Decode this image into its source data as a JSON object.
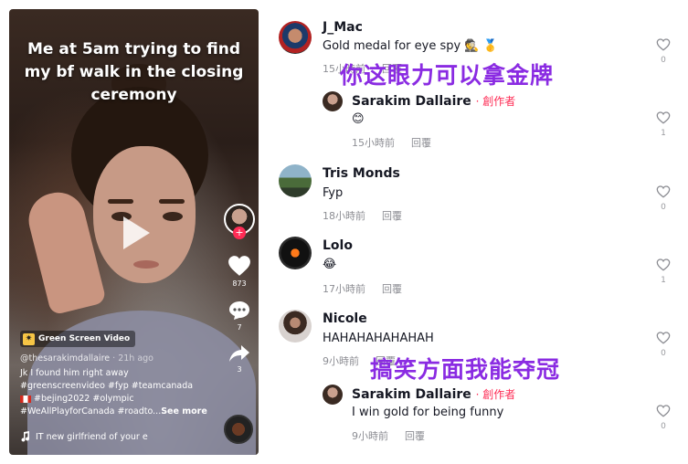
{
  "video": {
    "caption": "Me at 5am trying to find my bf walk in the closing ceremony",
    "badge": "Green Screen Video",
    "handle": "@thesarakimdallaire",
    "time": "· 21h ago",
    "description_line1": "Jk I found him right away",
    "description_line2": "#greenscreenvideo #fyp #teamcanada",
    "description_line3": "#bejing2022 #olympic",
    "description_line4": "#WeAllPlayforCanada #roadto...",
    "see_more": "See more",
    "music": "IT new girlfriend of your e",
    "likes": "873",
    "comments": "7",
    "shares": "3",
    "colors": {
      "accent": "#fe2c55"
    }
  },
  "comments": [
    {
      "name": "J_Mac",
      "text": "Gold medal for eye spy 🕵 🥇",
      "time": "15小時前",
      "reply": "回覆",
      "likes": "0"
    },
    {
      "name": "Sarakim Dallaire",
      "creator": "· 創作者",
      "text": "😊",
      "time": "15小時前",
      "reply": "回覆",
      "likes": "1"
    },
    {
      "name": "Tris Monds",
      "text": "Fyp",
      "time": "18小時前",
      "reply": "回覆",
      "likes": "0"
    },
    {
      "name": "Lolo",
      "text": "😂",
      "time": "17小時前",
      "reply": "回覆",
      "likes": "1"
    },
    {
      "name": "Nicole",
      "text": "HAHAHAHAHAHAH",
      "time": "9小時前",
      "reply": "回覆",
      "likes": "0"
    },
    {
      "name": "Sarakim Dallaire",
      "creator": "· 創作者",
      "text": "I win gold for being funny",
      "time": "9小時前",
      "reply": "回覆",
      "likes": "0"
    }
  ],
  "overlays": {
    "line1": "你这眼力可以拿金牌",
    "line2": "搞笑方面我能夺冠",
    "color": "#8a2be2"
  }
}
